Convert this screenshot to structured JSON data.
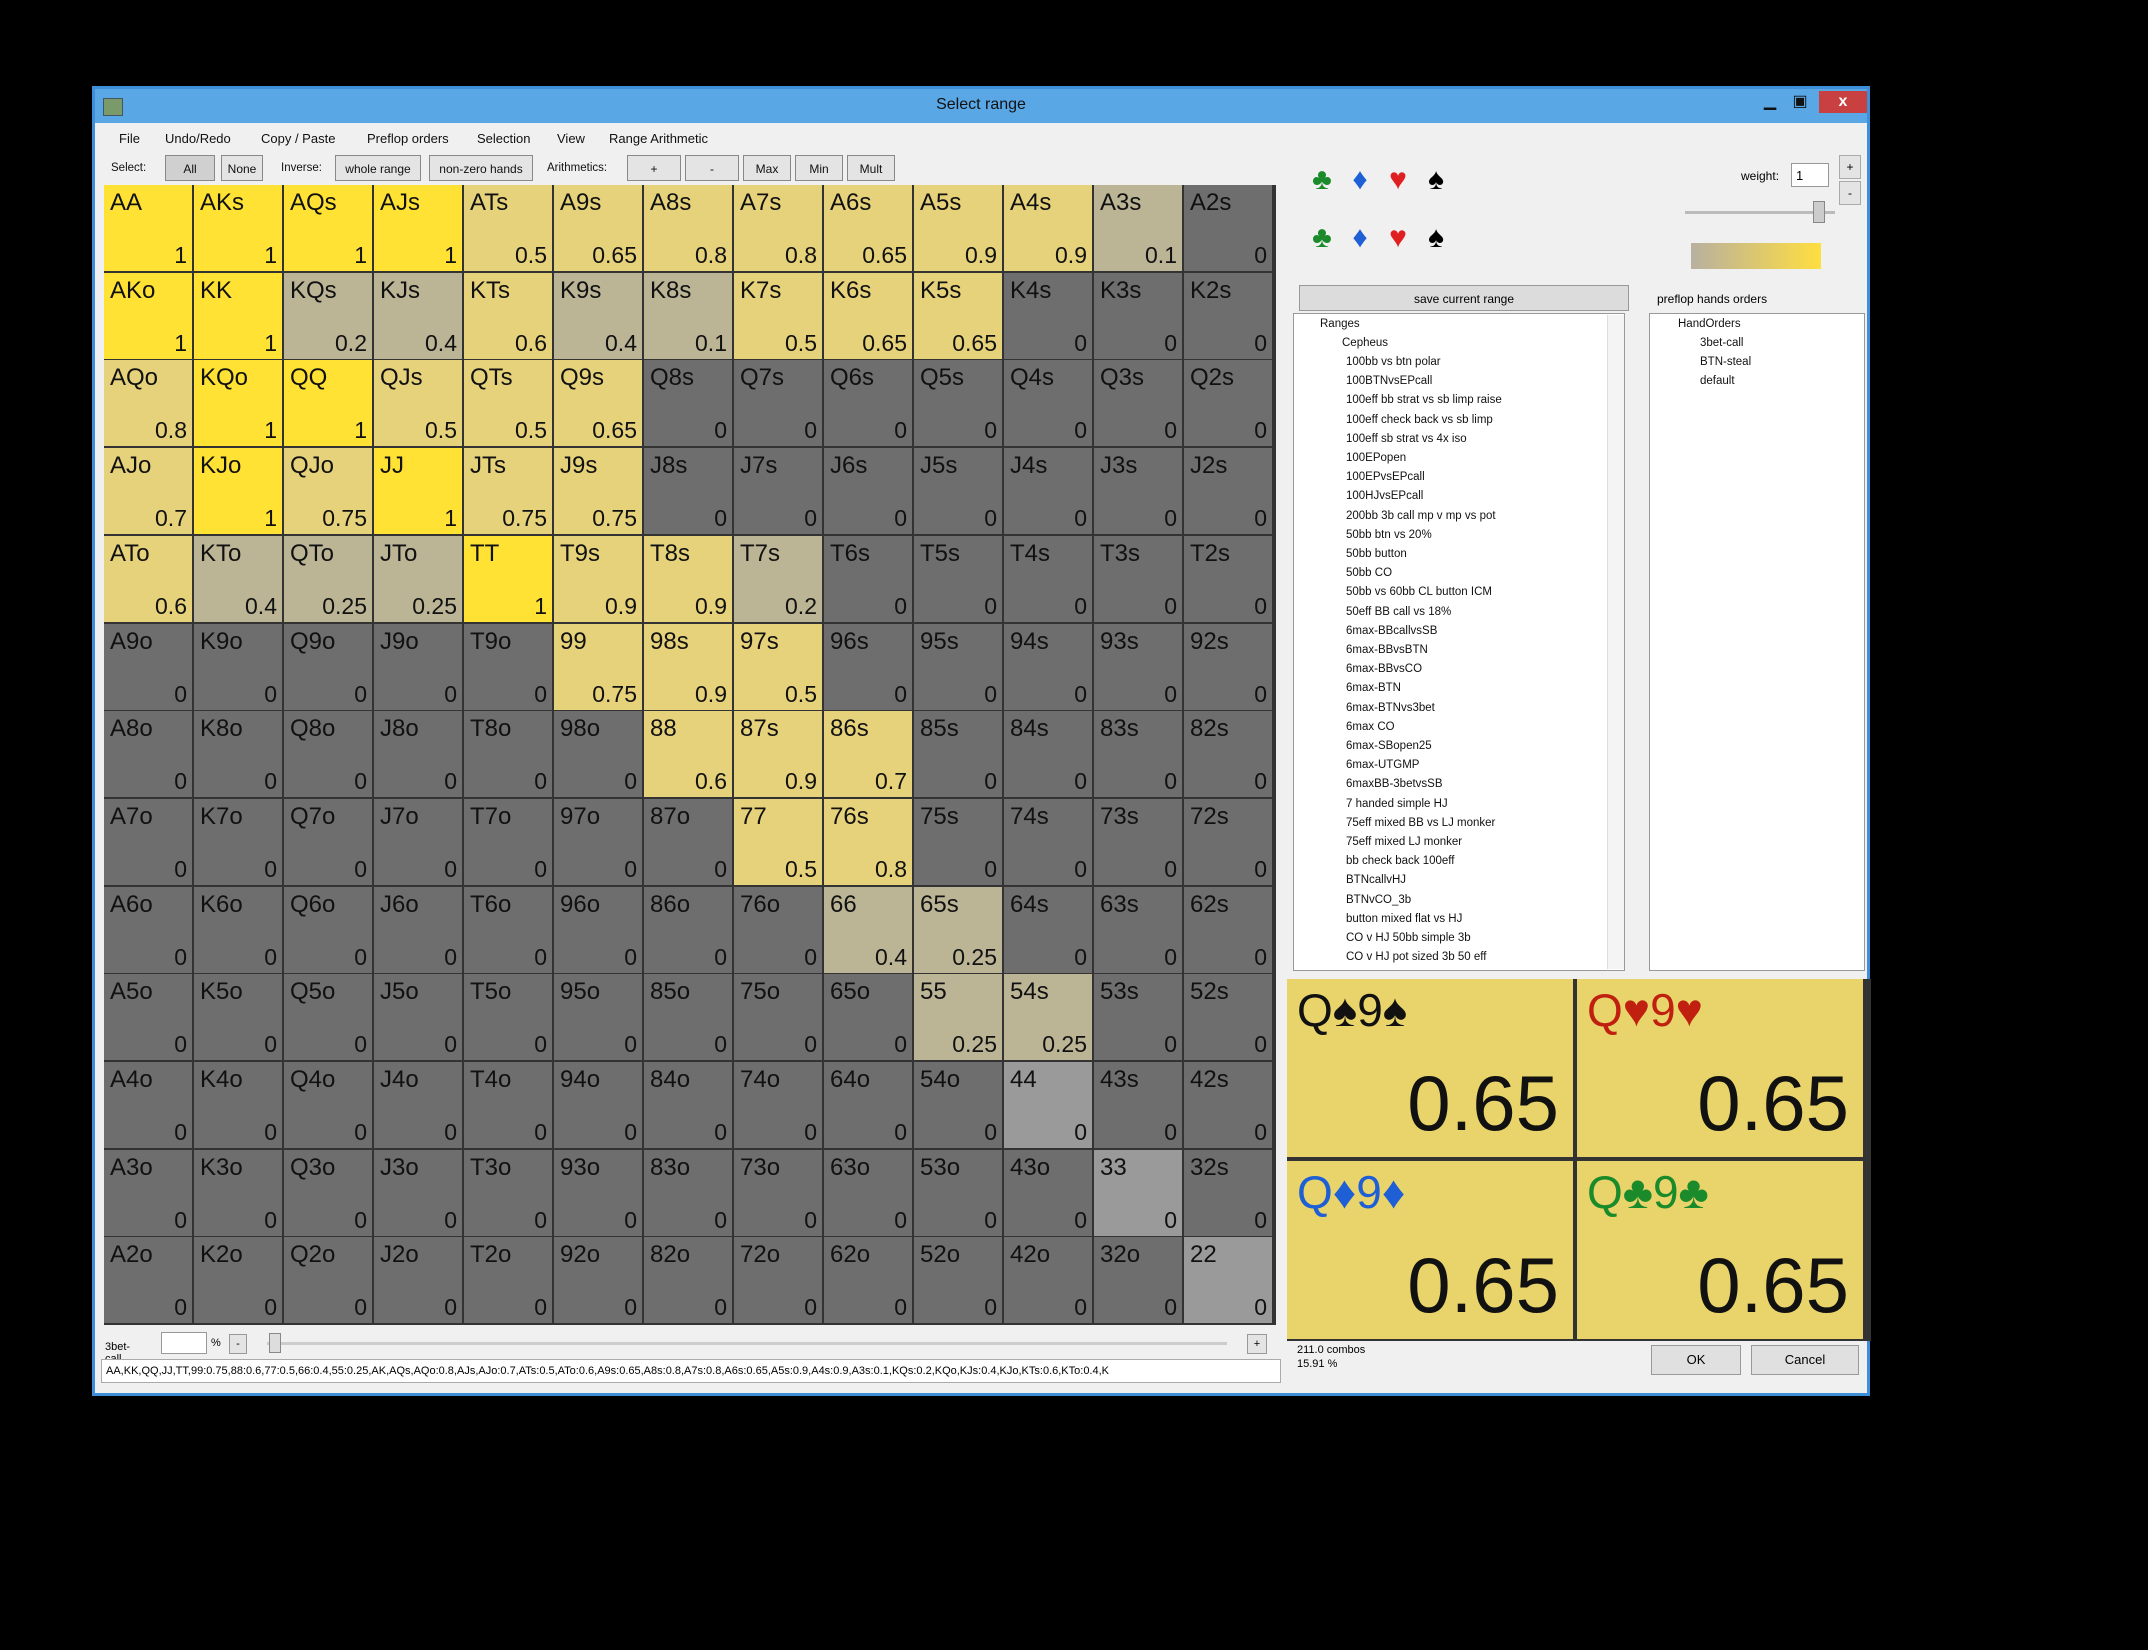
{
  "window": {
    "title": "Select range",
    "min_glyph": "▁",
    "max_glyph": "▣",
    "close_glyph": "x"
  },
  "menu": [
    "File",
    "Undo/Redo",
    "Copy / Paste",
    "Preflop orders",
    "Selection",
    "View",
    "Range Arithmetic"
  ],
  "toolbar": {
    "select_label": "Select:",
    "all": "All",
    "none": "None",
    "inverse_label": "Inverse:",
    "whole_range": "whole range",
    "non_zero": "non-zero hands",
    "arith_label": "Arithmetics:",
    "plus": "+",
    "minus": "-",
    "max": "Max",
    "min": "Min",
    "mult": "Mult"
  },
  "grid": {
    "hands": [
      [
        "AA",
        "AKs",
        "AQs",
        "AJs",
        "ATs",
        "A9s",
        "A8s",
        "A7s",
        "A6s",
        "A5s",
        "A4s",
        "A3s",
        "A2s"
      ],
      [
        "AKo",
        "KK",
        "KQs",
        "KJs",
        "KTs",
        "K9s",
        "K8s",
        "K7s",
        "K6s",
        "K5s",
        "K4s",
        "K3s",
        "K2s"
      ],
      [
        "AQo",
        "KQo",
        "QQ",
        "QJs",
        "QTs",
        "Q9s",
        "Q8s",
        "Q7s",
        "Q6s",
        "Q5s",
        "Q4s",
        "Q3s",
        "Q2s"
      ],
      [
        "AJo",
        "KJo",
        "QJo",
        "JJ",
        "JTs",
        "J9s",
        "J8s",
        "J7s",
        "J6s",
        "J5s",
        "J4s",
        "J3s",
        "J2s"
      ],
      [
        "ATo",
        "KTo",
        "QTo",
        "JTo",
        "TT",
        "T9s",
        "T8s",
        "T7s",
        "T6s",
        "T5s",
        "T4s",
        "T3s",
        "T2s"
      ],
      [
        "A9o",
        "K9o",
        "Q9o",
        "J9o",
        "T9o",
        "99",
        "98s",
        "97s",
        "96s",
        "95s",
        "94s",
        "93s",
        "92s"
      ],
      [
        "A8o",
        "K8o",
        "Q8o",
        "J8o",
        "T8o",
        "98o",
        "88",
        "87s",
        "86s",
        "85s",
        "84s",
        "83s",
        "82s"
      ],
      [
        "A7o",
        "K7o",
        "Q7o",
        "J7o",
        "T7o",
        "97o",
        "87o",
        "77",
        "76s",
        "75s",
        "74s",
        "73s",
        "72s"
      ],
      [
        "A6o",
        "K6o",
        "Q6o",
        "J6o",
        "T6o",
        "96o",
        "86o",
        "76o",
        "66",
        "65s",
        "64s",
        "63s",
        "62s"
      ],
      [
        "A5o",
        "K5o",
        "Q5o",
        "J5o",
        "T5o",
        "95o",
        "85o",
        "75o",
        "65o",
        "55",
        "54s",
        "53s",
        "52s"
      ],
      [
        "A4o",
        "K4o",
        "Q4o",
        "J4o",
        "T4o",
        "94o",
        "84o",
        "74o",
        "64o",
        "54o",
        "44",
        "43s",
        "42s"
      ],
      [
        "A3o",
        "K3o",
        "Q3o",
        "J3o",
        "T3o",
        "93o",
        "83o",
        "73o",
        "63o",
        "53o",
        "43o",
        "33",
        "32s"
      ],
      [
        "A2o",
        "K2o",
        "Q2o",
        "J2o",
        "T2o",
        "92o",
        "82o",
        "72o",
        "62o",
        "52o",
        "42o",
        "32o",
        "22"
      ]
    ],
    "weights": [
      [
        "1",
        "1",
        "1",
        "1",
        "0.5",
        "0.65",
        "0.8",
        "0.8",
        "0.65",
        "0.9",
        "0.9",
        "0.1",
        "0"
      ],
      [
        "1",
        "1",
        "0.2",
        "0.4",
        "0.6",
        "0.4",
        "0.1",
        "0.5",
        "0.65",
        "0.65",
        "0",
        "0",
        "0"
      ],
      [
        "0.8",
        "1",
        "1",
        "0.5",
        "0.5",
        "0.65",
        "0",
        "0",
        "0",
        "0",
        "0",
        "0",
        "0"
      ],
      [
        "0.7",
        "1",
        "0.75",
        "1",
        "0.75",
        "0.75",
        "0",
        "0",
        "0",
        "0",
        "0",
        "0",
        "0"
      ],
      [
        "0.6",
        "0.4",
        "0.25",
        "0.25",
        "1",
        "0.9",
        "0.9",
        "0.2",
        "0",
        "0",
        "0",
        "0",
        "0"
      ],
      [
        "0",
        "0",
        "0",
        "0",
        "0",
        "0.75",
        "0.9",
        "0.5",
        "0",
        "0",
        "0",
        "0",
        "0"
      ],
      [
        "0",
        "0",
        "0",
        "0",
        "0",
        "0",
        "0.6",
        "0.9",
        "0.7",
        "0",
        "0",
        "0",
        "0"
      ],
      [
        "0",
        "0",
        "0",
        "0",
        "0",
        "0",
        "0",
        "0.5",
        "0.8",
        "0",
        "0",
        "0",
        "0"
      ],
      [
        "0",
        "0",
        "0",
        "0",
        "0",
        "0",
        "0",
        "0",
        "0.4",
        "0.25",
        "0",
        "0",
        "0"
      ],
      [
        "0",
        "0",
        "0",
        "0",
        "0",
        "0",
        "0",
        "0",
        "0",
        "0.25",
        "0.25",
        "0",
        "0"
      ],
      [
        "0",
        "0",
        "0",
        "0",
        "0",
        "0",
        "0",
        "0",
        "0",
        "0",
        "0",
        "0",
        "0"
      ],
      [
        "0",
        "0",
        "0",
        "0",
        "0",
        "0",
        "0",
        "0",
        "0",
        "0",
        "0",
        "0",
        "0"
      ],
      [
        "0",
        "0",
        "0",
        "0",
        "0",
        "0",
        "0",
        "0",
        "0",
        "0",
        "0",
        "0",
        "0"
      ]
    ]
  },
  "colors": {
    "full": "#ffe233",
    "partial_high": "#e6d27a",
    "partial_low": "#bbb596",
    "zero_dark": "#6e6e6e",
    "zero_pair": "#9a9a9a",
    "combo_bg": "#e8d46a"
  },
  "suit_selector": {
    "icons": [
      "club-icon",
      "diamond-icon",
      "heart-icon",
      "spade-icon"
    ],
    "glyphs": [
      "♣",
      "♦",
      "♥",
      "♠"
    ]
  },
  "weight": {
    "label": "weight:",
    "value": "1"
  },
  "save_button": "save current range",
  "orders_label": "preflop hands orders",
  "ranges_tree": {
    "root": "Ranges",
    "folder": "Cepheus",
    "items": [
      "100bb vs btn polar",
      "100BTNvsEPcall",
      "100eff bb strat vs sb limp raise",
      "100eff check back vs sb limp",
      "100eff sb strat vs 4x iso",
      "100EPopen",
      "100EPvsEPcall",
      "100HJvsEPcall",
      "200bb 3b call mp v mp vs pot",
      "50bb btn vs 20%",
      "50bb button",
      "50bb CO",
      "50bb vs 60bb CL button ICM",
      "50eff BB call vs 18%",
      "6max-BBcallvsSB",
      "6max-BBvsBTN",
      "6max-BBvsCO",
      "6max-BTN",
      "6max-BTNvs3bet",
      "6max CO",
      "6max-SBopen25",
      "6max-UTGMP",
      "6maxBB-3betvsSB",
      "7 handed simple HJ",
      "75eff mixed BB vs LJ monker",
      "75eff mixed LJ monker",
      "bb check back 100eff",
      "BTNcallvHJ",
      "BTNvCO_3b",
      "button mixed flat vs HJ",
      "CO v HJ 50bb simple 3b",
      "CO v HJ pot sized 3b 50 eff"
    ]
  },
  "orders_tree": {
    "root": "HandOrders",
    "items": [
      "3bet-call",
      "BTN-steal",
      "default"
    ]
  },
  "combos": [
    {
      "label": "Q♠9♠",
      "value": "0.65",
      "color": "#111111"
    },
    {
      "label": "Q♥9♥",
      "value": "0.65",
      "color": "#c02010"
    },
    {
      "label": "Q♦9♦",
      "value": "0.65",
      "color": "#1e5fd6"
    },
    {
      "label": "Q♣9♣",
      "value": "0.65",
      "color": "#1a8a2a"
    }
  ],
  "bottom": {
    "order_label": "3bet-call",
    "pct_sign": "%",
    "minus": "-",
    "plus": "+",
    "range_string": "AA,KK,QQ,JJ,TT,99:0.75,88:0.6,77:0.5,66:0.4,55:0.25,AK,AQs,AQo:0.8,AJs,AJo:0.7,ATs:0.5,ATo:0.6,A9s:0.65,A8s:0.8,A7s:0.8,A6s:0.65,A5s:0.9,A4s:0.9,A3s:0.1,KQs:0.2,KQo,KJs:0.4,KJo,KTs:0.6,KTo:0.4,K"
  },
  "stats": {
    "combos": "211.0 combos",
    "percent": "15.91 %"
  },
  "ok": "OK",
  "cancel": "Cancel"
}
